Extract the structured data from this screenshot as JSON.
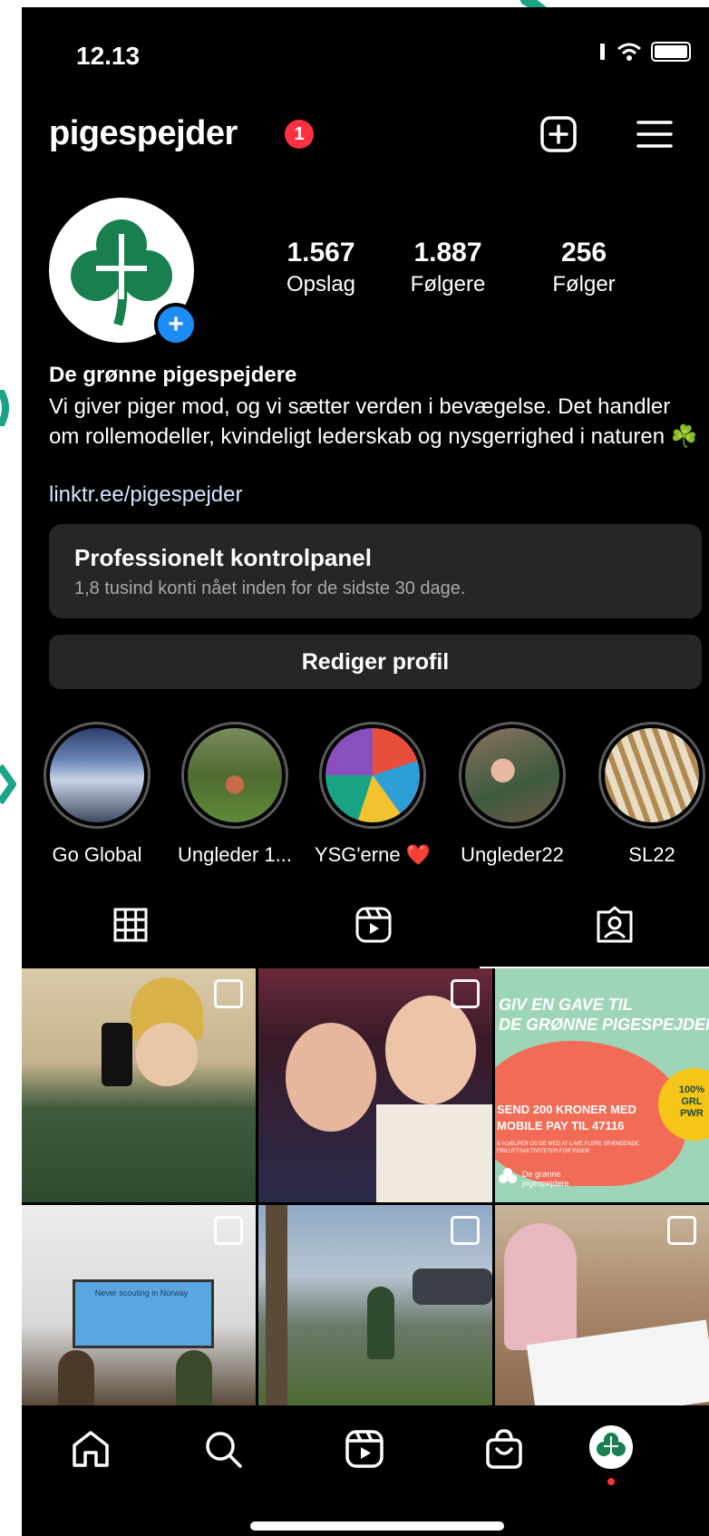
{
  "status": {
    "time": "12.13"
  },
  "header": {
    "username": "pigespejder",
    "notification_count": "1"
  },
  "stats": [
    {
      "value": "1.567",
      "label": "Opslag"
    },
    {
      "value": "1.887",
      "label": "Følgere"
    },
    {
      "value": "256",
      "label": "Følger"
    }
  ],
  "bio": {
    "name": "De grønne pigespejdere",
    "text": "Vi giver piger mod, og vi sætter verden i bevægelse. Det handler om rollemodeller, kvindeligt lederskab og nysgerrighed i naturen ☘️",
    "link": "linktr.ee/pigespejder"
  },
  "dashboard": {
    "title": "Professionelt kontrolpanel",
    "subtitle": "1,8 tusind konti nået inden for de sidste 30 dage."
  },
  "edit_profile": "Rediger profil",
  "highlights": [
    {
      "label": "Go Global"
    },
    {
      "label": "Ungleder 1..."
    },
    {
      "label": "YSG'erne ❤️"
    },
    {
      "label": "Ungleder22"
    },
    {
      "label": "SL22"
    }
  ],
  "posts": {
    "donation": {
      "headline_1": "GIV EN GAVE TIL",
      "headline_2": "DE GRØNNE PIGESPEJDERE",
      "line_1": "SEND 200 KRONER MED",
      "line_2": "MOBILE PAY TIL 47116",
      "small": "& HJÆLPER OS DE MED AT LAVE FLERE SPÆNDENDE FRILUFTSAKTIVITETER FOR PIGER",
      "badge": "100% GRL PWR",
      "logo_text": "De grønne pigespejdere"
    },
    "screen_text": "Never scouting in Norway"
  },
  "colors": {
    "background": "#000000",
    "panel": "#262626",
    "accent_blue": "#1d8cf8",
    "badge_red": "#ff3040",
    "arrow_teal": "#1aa486",
    "brand_green": "#1a7f4e"
  }
}
